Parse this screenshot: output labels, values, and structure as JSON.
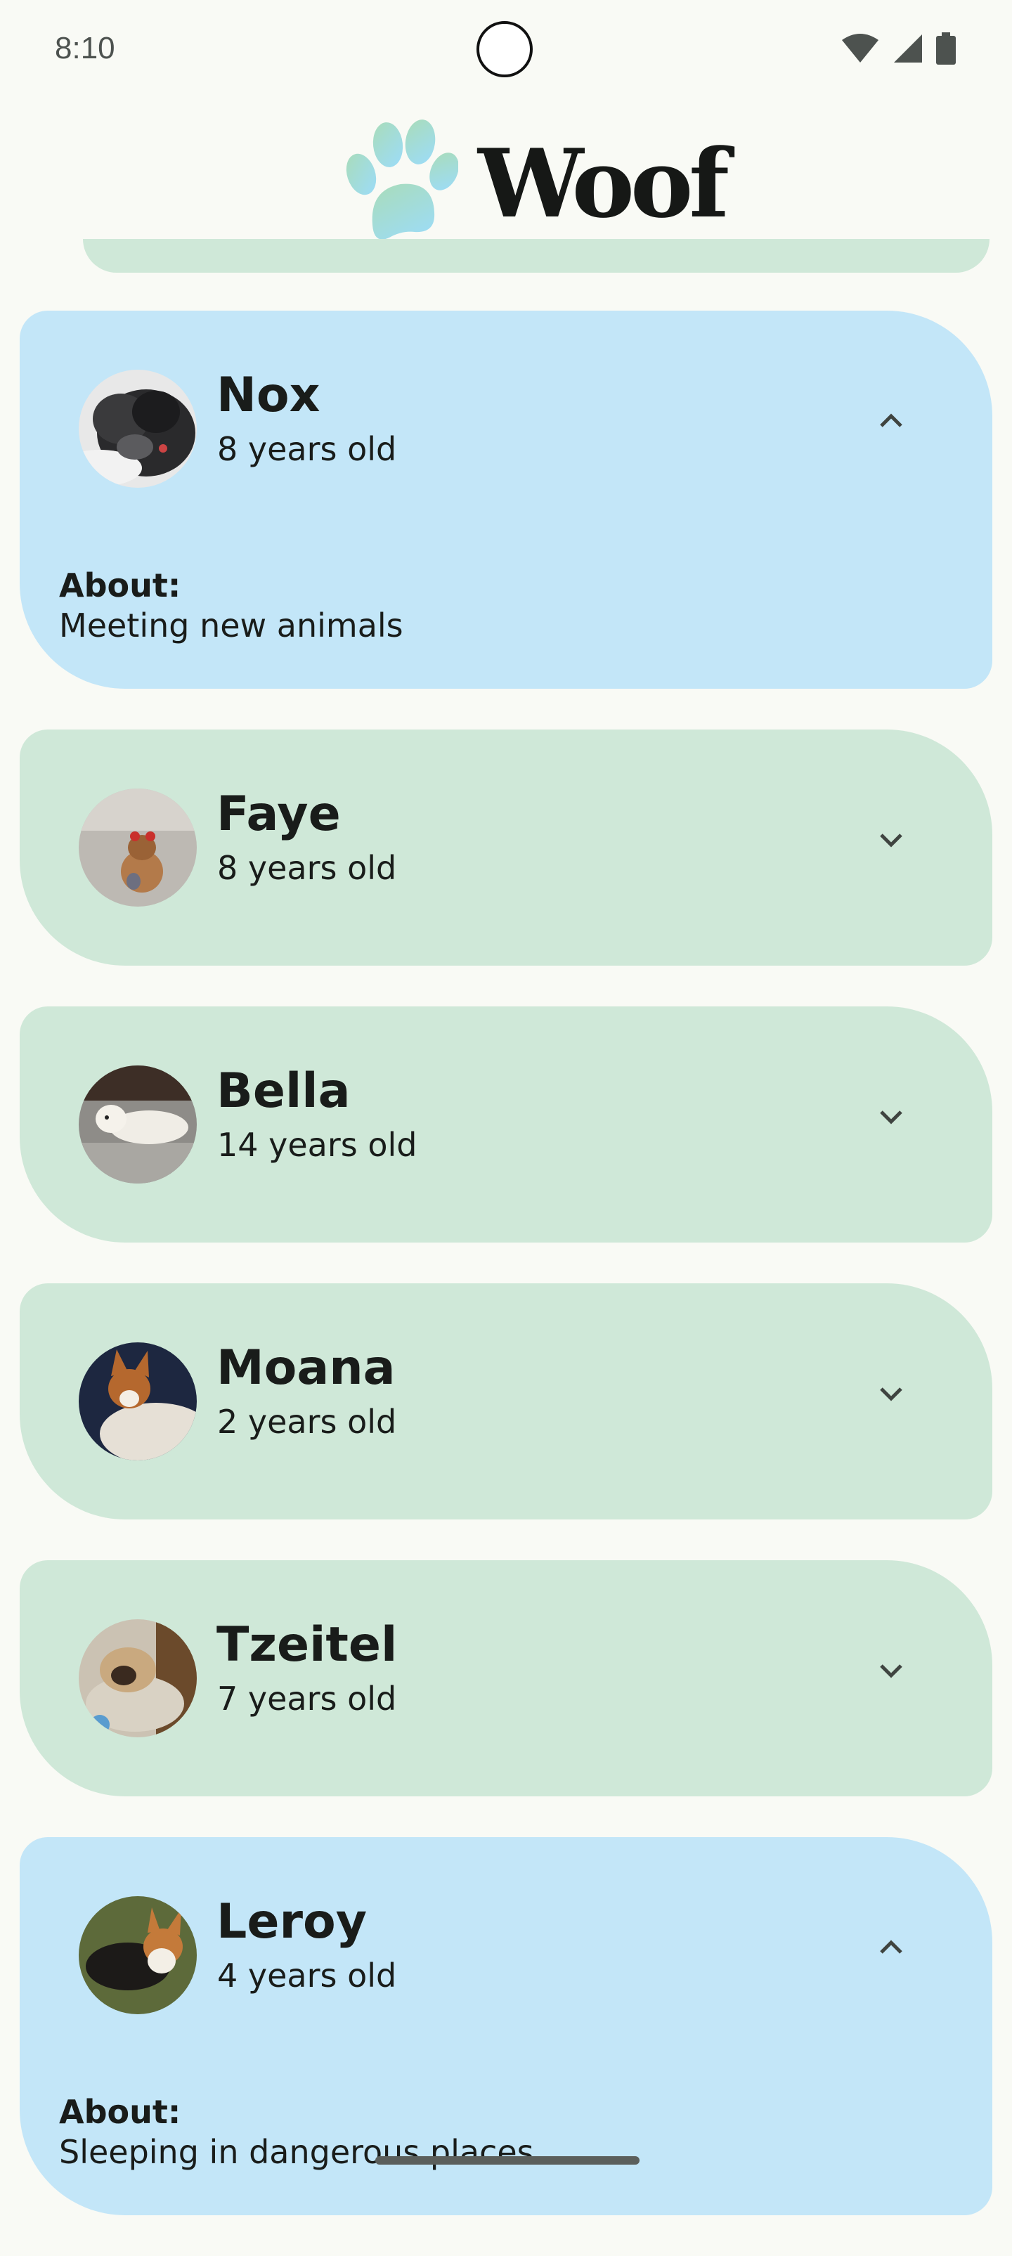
{
  "status_bar": {
    "time": "8:10",
    "icons": [
      "wifi-icon",
      "signal-icon",
      "battery-icon"
    ]
  },
  "app_bar": {
    "title": "Woof",
    "logo_icon": "paw-icon"
  },
  "colors": {
    "background": "#f9faf5",
    "card_collapsed": "#cfe8d8",
    "card_expanded": "#c3e6f8",
    "text": "#191c1a"
  },
  "dogs": [
    {
      "name": "Nox",
      "age": "8 years old",
      "expanded": true,
      "about_label": "About:",
      "hobby": "Meeting new animals",
      "icon": "expand-less-icon"
    },
    {
      "name": "Faye",
      "age": "8 years old",
      "expanded": false,
      "icon": "expand-more-icon"
    },
    {
      "name": "Bella",
      "age": "14 years old",
      "expanded": false,
      "icon": "expand-more-icon"
    },
    {
      "name": "Moana",
      "age": "2 years old",
      "expanded": false,
      "icon": "expand-more-icon"
    },
    {
      "name": "Tzeitel",
      "age": "7 years old",
      "expanded": false,
      "icon": "expand-more-icon"
    },
    {
      "name": "Leroy",
      "age": "4 years old",
      "expanded": true,
      "about_label": "About:",
      "hobby": "Sleeping in dangerous places",
      "icon": "expand-less-icon"
    }
  ]
}
